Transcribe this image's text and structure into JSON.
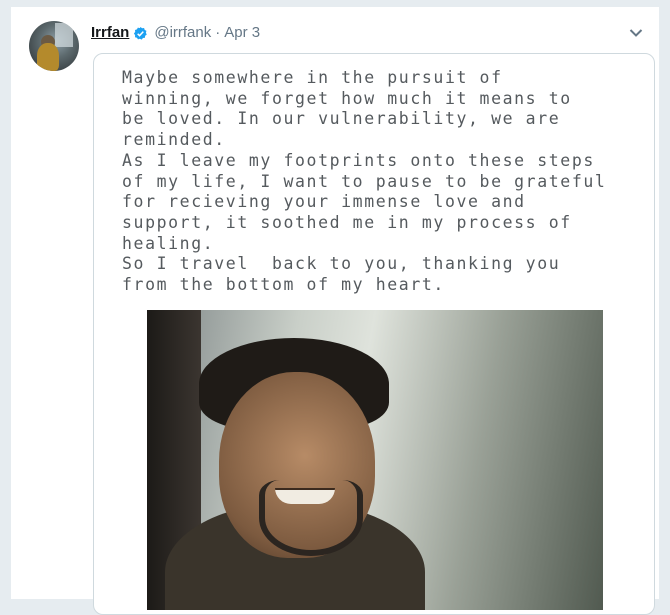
{
  "tweet": {
    "display_name": "Irrfan",
    "handle": "@irrfank",
    "separator": "·",
    "date": "Apr 3",
    "verified_icon": "verified-badge-icon",
    "colors": {
      "verified": "#1da1f2",
      "muted": "#657786",
      "name": "#14171a"
    }
  },
  "note": {
    "lines": [
      "Maybe somewhere in the pursuit of",
      "winning, we forget how much it means to",
      "be loved. In our vulnerability, we are",
      "reminded.",
      "As I leave my footprints onto these steps",
      "of my life, I want to pause to be grateful",
      "for recieving your immense love and",
      "support, it soothed me in my process of",
      "healing.",
      "So I travel  back to you, thanking you",
      "from the bottom of my heart."
    ]
  }
}
